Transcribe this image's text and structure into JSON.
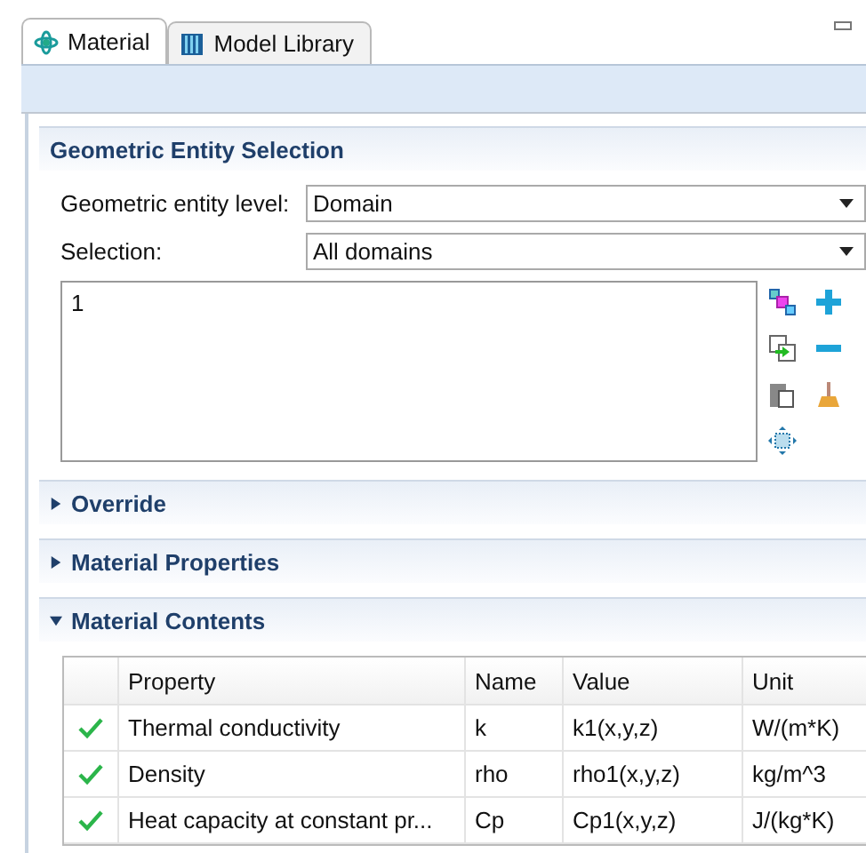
{
  "tabs": [
    {
      "label": "Material",
      "kind": "material",
      "selected": true
    },
    {
      "label": "Model Library",
      "kind": "library",
      "selected": false
    }
  ],
  "geometric_entity_selection": {
    "title": "Geometric Entity Selection",
    "expanded": true,
    "entity_level": {
      "label": "Geometric entity level:",
      "value": "Domain"
    },
    "selection": {
      "label": "Selection:",
      "value": "All domains"
    },
    "selected_items": [
      "1"
    ]
  },
  "sections": [
    {
      "title": "Override",
      "expanded": false
    },
    {
      "title": "Material Properties",
      "expanded": false
    }
  ],
  "material_contents": {
    "title": "Material Contents",
    "expanded": true,
    "columns": [
      "Property",
      "Name",
      "Value",
      "Unit"
    ],
    "rows": [
      {
        "checked": true,
        "property": "Thermal conductivity",
        "name": "k",
        "value": "k1(x,y,z)",
        "unit": "W/(m*K)"
      },
      {
        "checked": true,
        "property": "Density",
        "name": "rho",
        "value": "rho1(x,y,z)",
        "unit": "kg/m^3"
      },
      {
        "checked": true,
        "property": "Heat capacity at constant pr...",
        "name": "Cp",
        "value": "Cp1(x,y,z)",
        "unit": "J/(kg*K)"
      }
    ]
  }
}
